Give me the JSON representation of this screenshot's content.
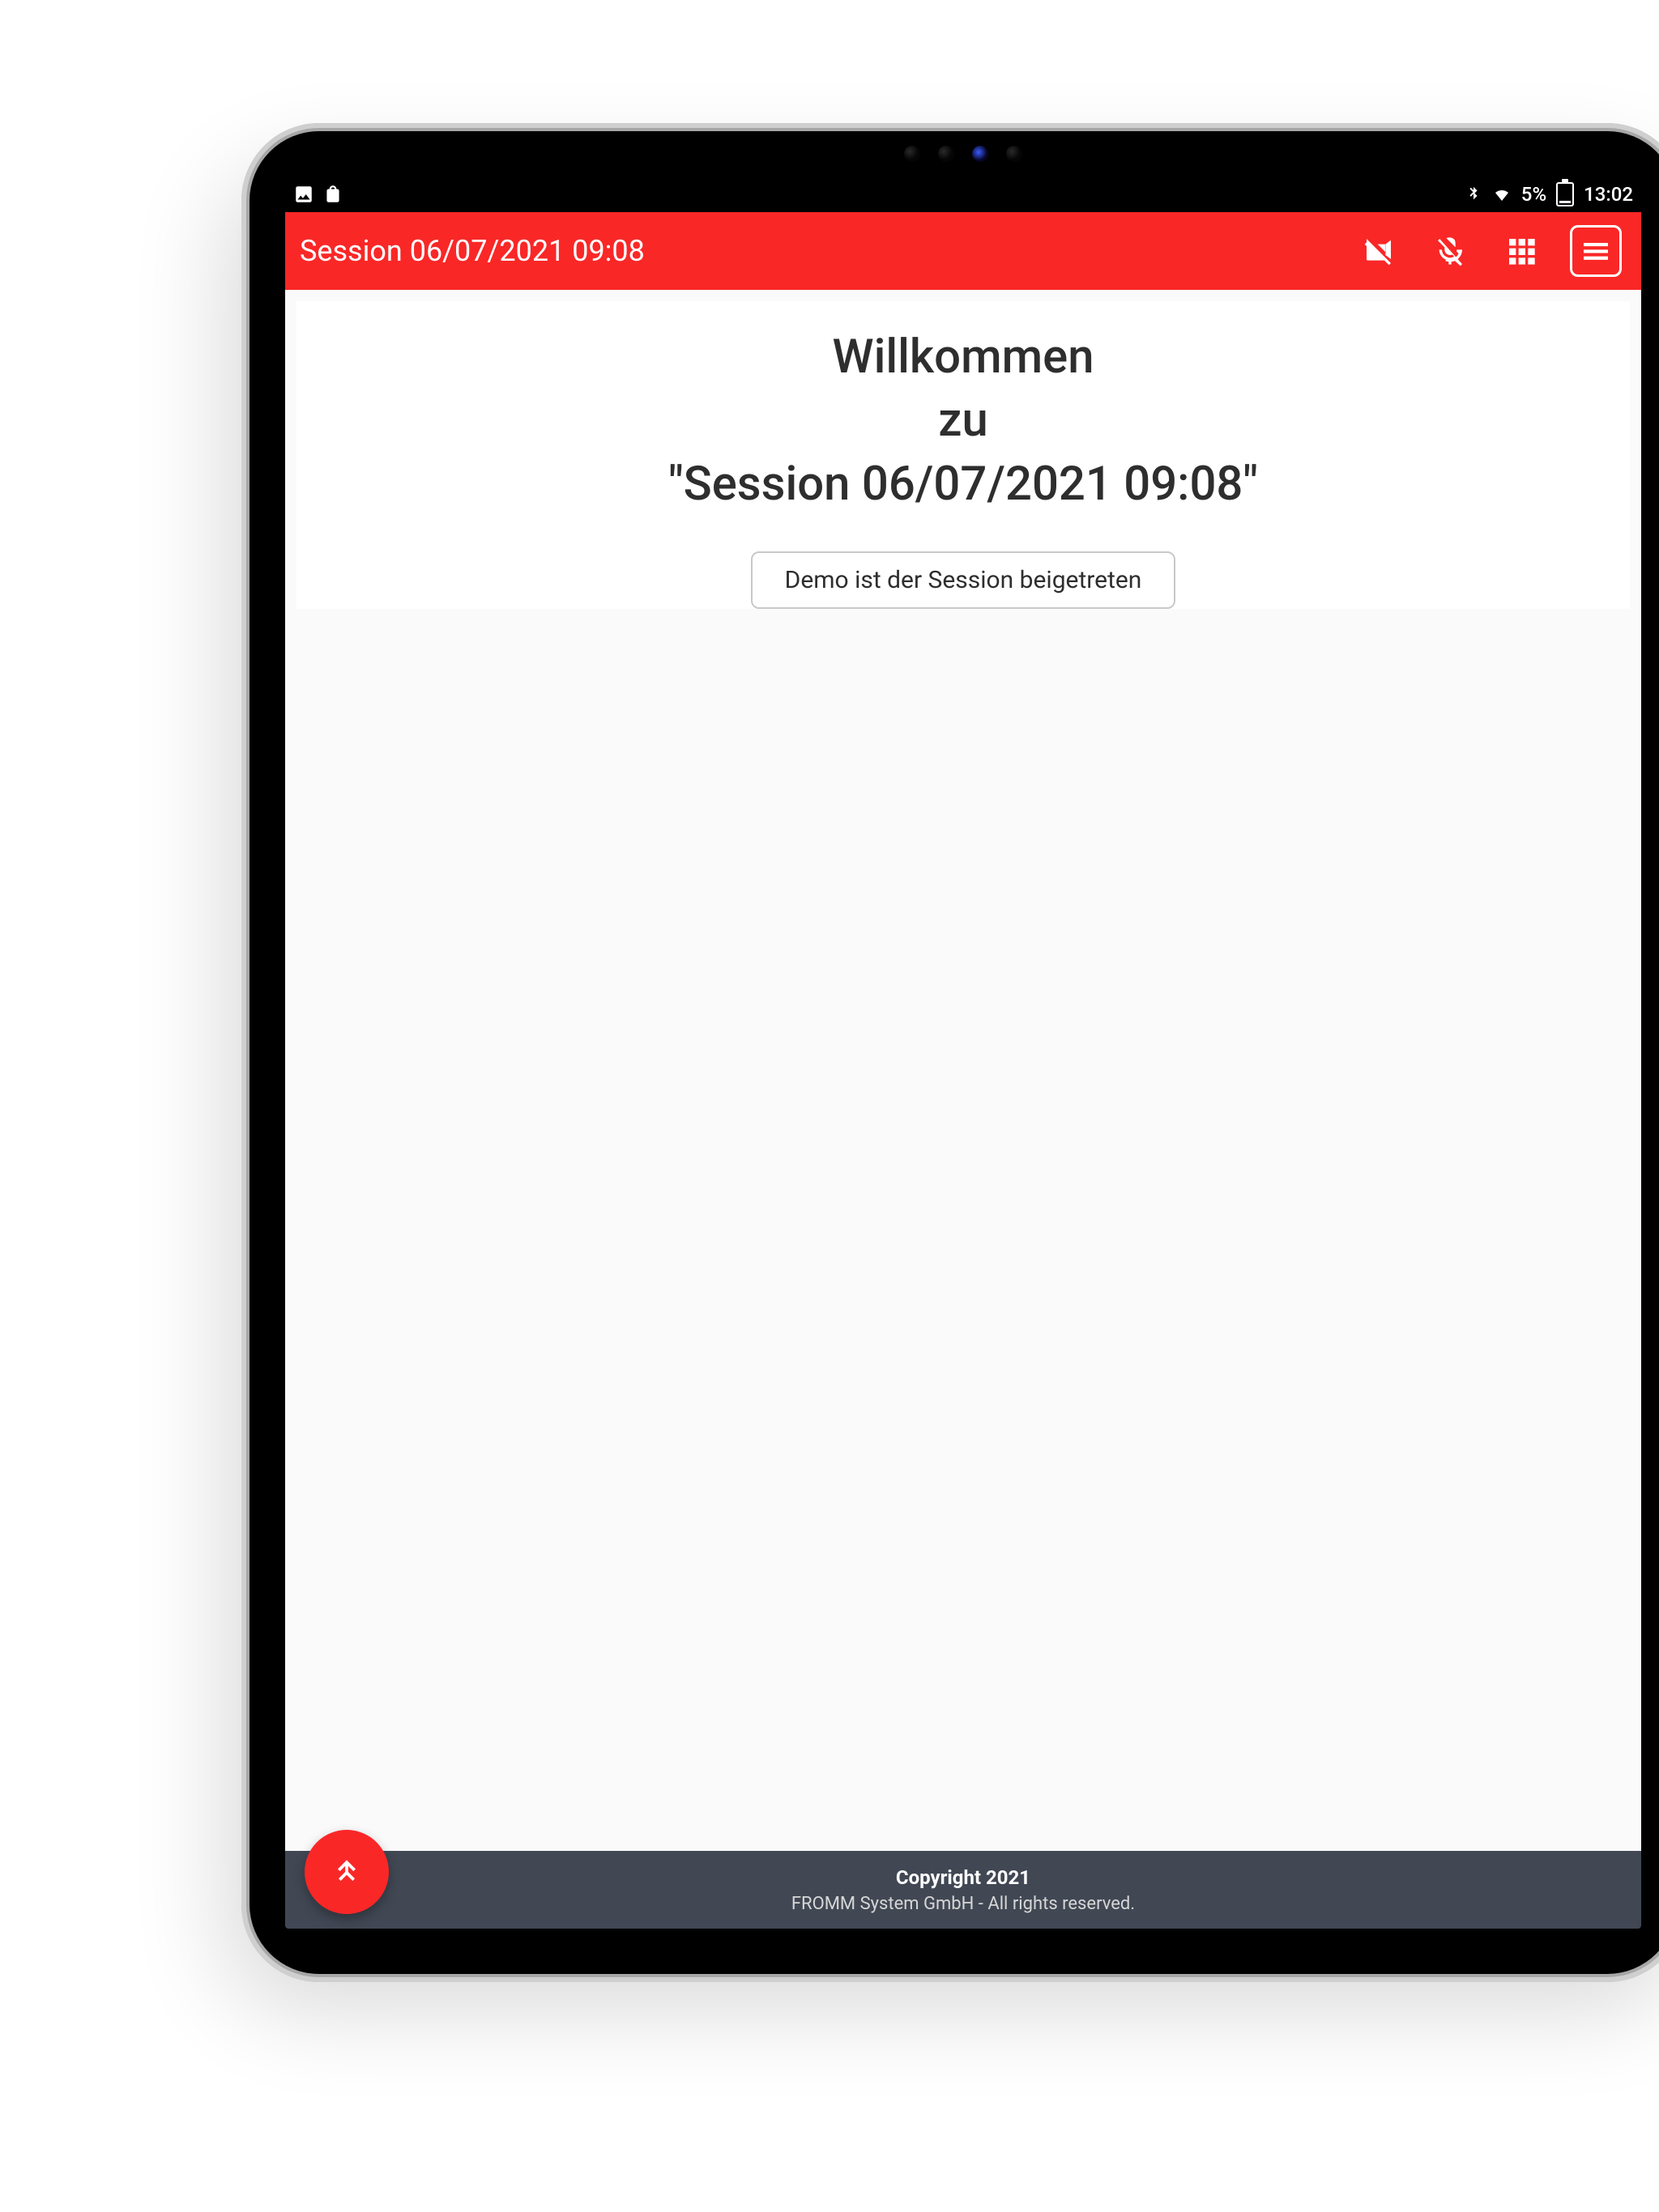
{
  "statusbar": {
    "battery_pct": "5%",
    "clock": "13:02"
  },
  "header": {
    "title": "Session 06/07/2021 09:08"
  },
  "main": {
    "welcome_line1": "Willkommen",
    "welcome_line2": "zu",
    "welcome_line3": "\"Session 06/07/2021 09:08\"",
    "join_notice": "Demo ist der Session beigetreten"
  },
  "footer": {
    "copyright": "Copyright 2021",
    "company": "FROMM System GmbH - All rights reserved."
  }
}
